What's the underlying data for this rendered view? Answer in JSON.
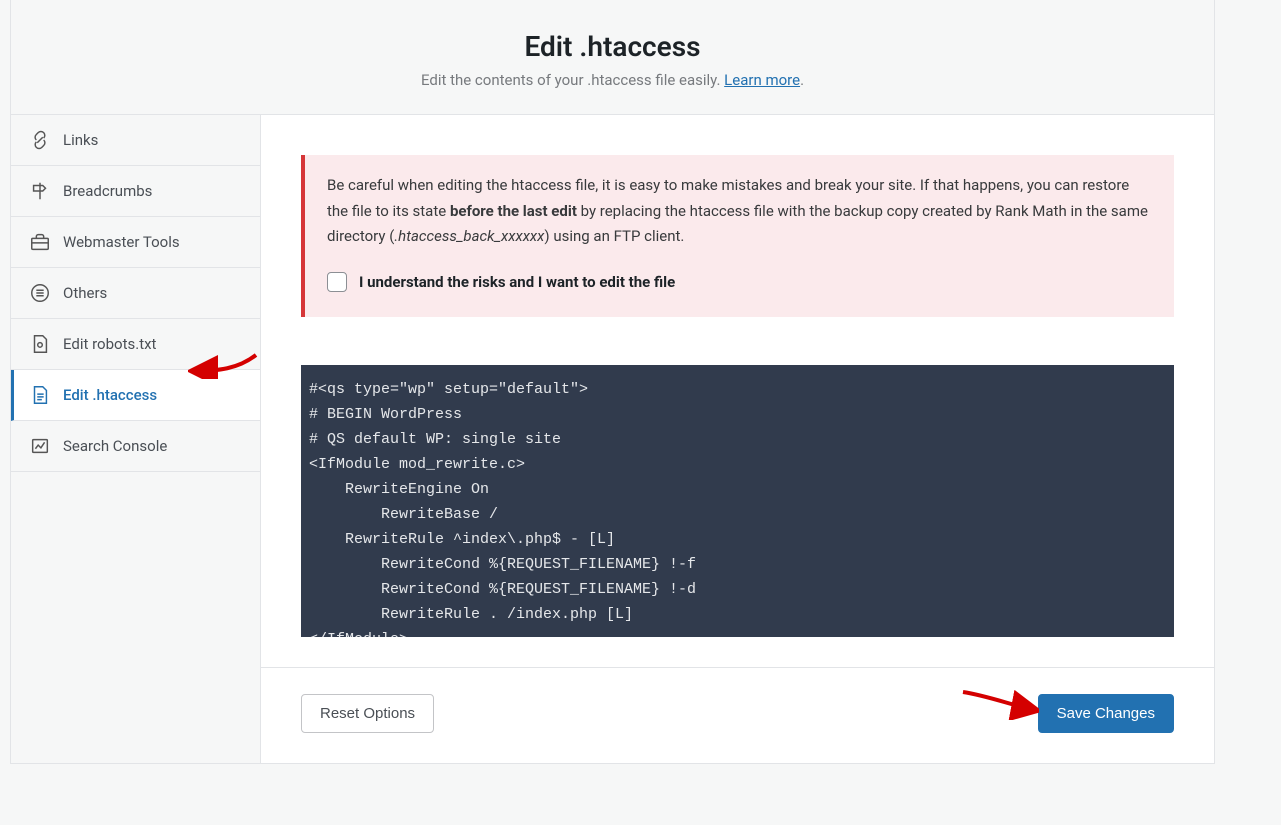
{
  "header": {
    "title": "Edit .htaccess",
    "subtitle_prefix": "Edit the contents of your .htaccess file easily. ",
    "learn_more": "Learn more",
    "subtitle_suffix": "."
  },
  "sidebar": {
    "items": [
      {
        "label": "Links",
        "icon": "link-icon"
      },
      {
        "label": "Breadcrumbs",
        "icon": "signpost-icon"
      },
      {
        "label": "Webmaster Tools",
        "icon": "toolbox-icon"
      },
      {
        "label": "Others",
        "icon": "list-icon"
      },
      {
        "label": "Edit robots.txt",
        "icon": "file-icon"
      },
      {
        "label": "Edit .htaccess",
        "icon": "file-lines-icon",
        "active": true
      },
      {
        "label": "Search Console",
        "icon": "chart-icon"
      }
    ]
  },
  "notice": {
    "text_a": "Be careful when editing the htaccess file, it is easy to make mistakes and break your site. If that happens, you can restore the file to its state ",
    "bold": "before the last edit",
    "text_b": " by replacing the htaccess file with the backup copy created by Rank Math in the same directory (",
    "italic": ".htaccess_back_xxxxxx",
    "text_c": ") using an FTP client.",
    "ack_label": "I understand the risks and I want to edit the file"
  },
  "editor": {
    "content": "#<qs type=\"wp\" setup=\"default\">\n# BEGIN WordPress\n# QS default WP: single site\n<IfModule mod_rewrite.c>\n    RewriteEngine On\n        RewriteBase /\n    RewriteRule ^index\\.php$ - [L]\n        RewriteCond %{REQUEST_FILENAME} !-f\n        RewriteCond %{REQUEST_FILENAME} !-d\n        RewriteRule . /index.php [L]\n</IfModule>\n# END WordPress\n#</qs>"
  },
  "footer": {
    "reset": "Reset Options",
    "save": "Save Changes"
  }
}
